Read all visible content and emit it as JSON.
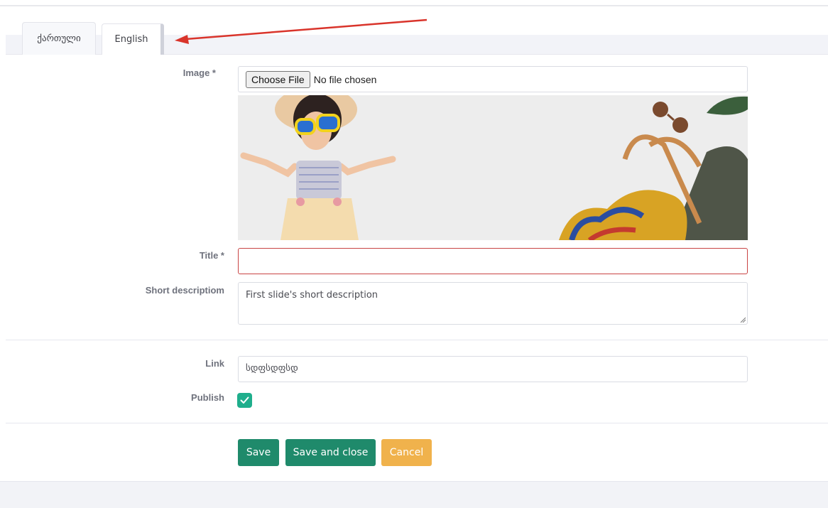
{
  "tabs": [
    {
      "label": "ქართული",
      "active": false
    },
    {
      "label": "English",
      "active": true
    }
  ],
  "form": {
    "image_label": "Image *",
    "file_button": "Choose File",
    "file_status": "No file chosen",
    "title_label": "Title *",
    "title_value": "",
    "short_desc_label": "Short descriptiom",
    "short_desc_value": "First slide's short description",
    "link_label": "Link",
    "link_value": "სდფსდფსდ",
    "publish_label": "Publish",
    "publish_checked": true
  },
  "actions": {
    "save": "Save",
    "save_close": "Save and close",
    "cancel": "Cancel"
  },
  "colors": {
    "primary": "#1f8a6b",
    "warning": "#f0b24c",
    "checkbox": "#1fae8c",
    "error_border": "#c94444",
    "annotation_arrow": "#d9342b"
  }
}
